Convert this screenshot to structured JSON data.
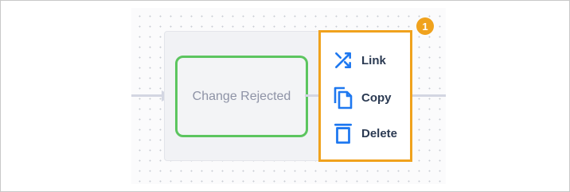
{
  "node": {
    "label": "Change Rejected",
    "border_color": "#5cc55f"
  },
  "context_menu": {
    "accent_color": "#f0a21d",
    "icon_color": "#1e78f0",
    "items": [
      {
        "label": "Link",
        "icon": "shuffle-icon"
      },
      {
        "label": "Copy",
        "icon": "copy-icon"
      },
      {
        "label": "Delete",
        "icon": "trash-icon"
      }
    ]
  },
  "callout": {
    "number": "1"
  }
}
